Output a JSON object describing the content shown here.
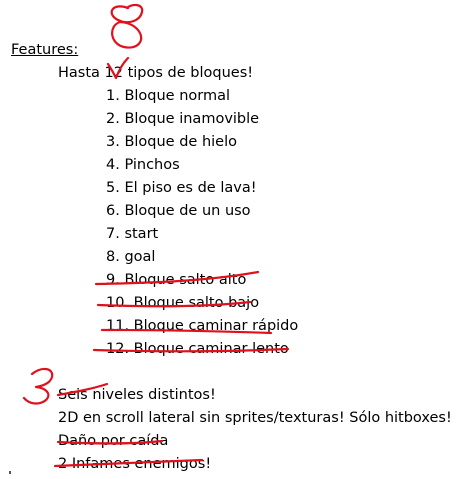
{
  "heading": "Features:",
  "intro": "Hasta 12 tipos de bloques!",
  "blocks": [
    {
      "text": "1. Bloque normal",
      "struck": false
    },
    {
      "text": "2. Bloque inamovible",
      "struck": false
    },
    {
      "text": "3. Bloque de hielo",
      "struck": false
    },
    {
      "text": "4. Pinchos",
      "struck": false
    },
    {
      "text": "5. El piso es de lava!",
      "struck": false
    },
    {
      "text": "6. Bloque de un uso",
      "struck": false
    },
    {
      "text": "7. start",
      "struck": false
    },
    {
      "text": "8. goal",
      "struck": false
    },
    {
      "text": "9. Bloque salto alto",
      "struck": true
    },
    {
      "text": "10. Bloque salto bajo",
      "struck": true
    },
    {
      "text": "11. Bloque caminar rápido",
      "struck": true
    },
    {
      "text": "12. Bloque caminar lento",
      "struck": true
    }
  ],
  "features": [
    {
      "text": "Seis niveles distintos!",
      "struck": false
    },
    {
      "text": "2D en scroll lateral sin sprites/texturas! Sólo hitboxes!",
      "struck": false
    },
    {
      "text": "Daño por caída",
      "struck": true
    },
    {
      "text": "2 Infames enemigos!",
      "struck": true
    }
  ],
  "handwritten": {
    "top_number": "8",
    "side_number": "3",
    "ink_color": "#e0101c"
  }
}
